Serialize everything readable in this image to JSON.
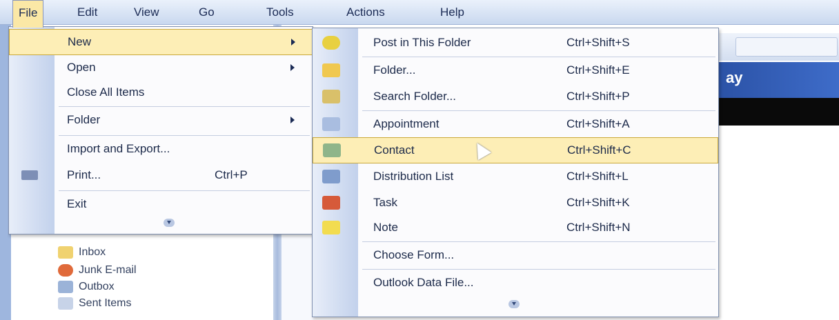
{
  "menubar": {
    "items": [
      "File",
      "Edit",
      "View",
      "Go",
      "Tools",
      "Actions",
      "Help"
    ]
  },
  "background": {
    "title_fragment": "ay",
    "folders": [
      "Inbox",
      "Junk E-mail",
      "Outbox",
      "Sent Items"
    ]
  },
  "file_menu": {
    "items": [
      {
        "label": "New",
        "shortcut": "",
        "submenu": true
      },
      {
        "label": "Open",
        "shortcut": "",
        "submenu": true
      },
      {
        "label": "Close All Items",
        "shortcut": "",
        "submenu": false
      },
      {
        "label": "Folder",
        "shortcut": "",
        "submenu": true
      },
      {
        "label": "Import and Export...",
        "shortcut": "",
        "submenu": false
      },
      {
        "label": "Print...",
        "shortcut": "Ctrl+P",
        "submenu": false
      },
      {
        "label": "Exit",
        "shortcut": "",
        "submenu": false
      }
    ]
  },
  "new_submenu": {
    "items": [
      {
        "label": "Post in This Folder",
        "shortcut": "Ctrl+Shift+S",
        "icon": "post-icon"
      },
      {
        "label": "Folder...",
        "shortcut": "Ctrl+Shift+E",
        "icon": "folder-icon"
      },
      {
        "label": "Search Folder...",
        "shortcut": "Ctrl+Shift+P",
        "icon": "search-folder-icon"
      },
      {
        "label": "Appointment",
        "shortcut": "Ctrl+Shift+A",
        "icon": "appointment-icon"
      },
      {
        "label": "Contact",
        "shortcut": "Ctrl+Shift+C",
        "icon": "contact-icon"
      },
      {
        "label": "Distribution List",
        "shortcut": "Ctrl+Shift+L",
        "icon": "distribution-list-icon"
      },
      {
        "label": "Task",
        "shortcut": "Ctrl+Shift+K",
        "icon": "task-icon"
      },
      {
        "label": "Note",
        "shortcut": "Ctrl+Shift+N",
        "icon": "note-icon"
      },
      {
        "label": "Choose Form...",
        "shortcut": "",
        "icon": ""
      },
      {
        "label": "Outlook Data File...",
        "shortcut": "",
        "icon": ""
      }
    ]
  },
  "colors": {
    "highlight": "#fdeeb6",
    "gutter": "#c2d1ec",
    "title_bar": "#2b52a6"
  }
}
